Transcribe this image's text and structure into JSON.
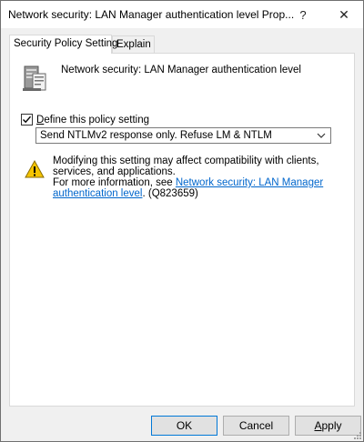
{
  "window": {
    "title": "Network security: LAN Manager authentication level Prop...",
    "help_glyph": "?",
    "close_glyph": "✕"
  },
  "tabs": [
    {
      "label": "Security Policy Setting",
      "active": true
    },
    {
      "label": "Explain",
      "active": false
    }
  ],
  "policy": {
    "icon": "server-policy-icon",
    "name": "Network security: LAN Manager authentication level"
  },
  "define_setting": {
    "label_accel": "D",
    "label_rest": "efine this policy setting",
    "checked": true
  },
  "dropdown": {
    "selected": "Send NTLMv2 response only. Refuse LM & NTLM"
  },
  "warning": {
    "icon": "warning-icon",
    "line1": "Modifying this setting may affect compatibility with clients, services, and applications.",
    "more_info_prefix": "For more information, see ",
    "link_text": "Network security: LAN Manager authentication level",
    "suffix": ". (Q823659)"
  },
  "buttons": {
    "ok": "OK",
    "cancel": "Cancel",
    "apply_accel": "A",
    "apply_rest": "pply"
  },
  "colors": {
    "link": "#0066cc",
    "accent_border": "#0078d7"
  }
}
